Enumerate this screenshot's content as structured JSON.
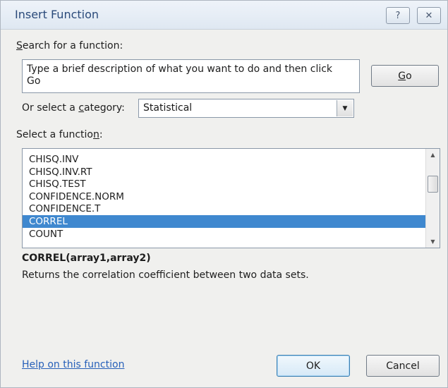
{
  "window": {
    "title": "Insert Function",
    "help_glyph": "?",
    "close_glyph": "✕"
  },
  "search": {
    "label_prefix": "",
    "label_accel": "S",
    "label_rest": "earch for a function:",
    "value_line1": "Type a brief description of what you want to do and then click",
    "value_line2": "Go",
    "go_accel": "G",
    "go_rest": "o"
  },
  "category": {
    "label_prefix": "Or select a ",
    "label_accel": "c",
    "label_rest": "ategory:",
    "selected": "Statistical"
  },
  "functions": {
    "label_prefix": "Select a functio",
    "label_accel": "n",
    "label_rest": ":",
    "items": [
      "CHISQ.INV",
      "CHISQ.INV.RT",
      "CHISQ.TEST",
      "CONFIDENCE.NORM",
      "CONFIDENCE.T",
      "CORREL",
      "COUNT"
    ],
    "selected_index": 5
  },
  "details": {
    "signature": "CORREL(array1,array2)",
    "description": "Returns the correlation coefficient between two data sets."
  },
  "footer": {
    "help_link": "Help on this function",
    "ok_label": "OK",
    "cancel_label": "Cancel"
  },
  "colors": {
    "selection": "#3f88cf",
    "link": "#2760b9",
    "title_text": "#2a4a7a"
  }
}
